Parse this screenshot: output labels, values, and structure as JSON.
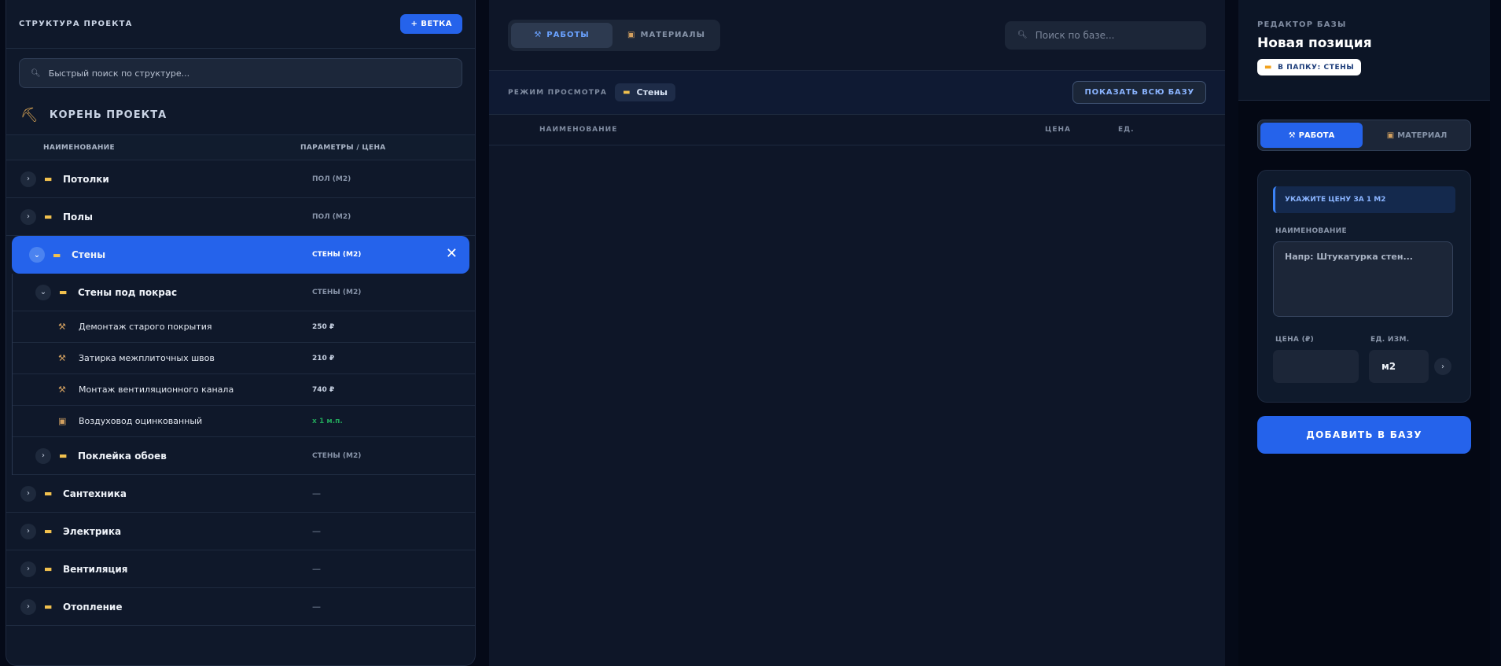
{
  "structure": {
    "title": "СТРУКТУРА ПРОЕКТА",
    "add_branch_label": "+ ВЕТКА",
    "search_placeholder": "Быстрый поиск по структуре...",
    "root_title": "КОРЕНЬ ПРОЕКТА",
    "col_name": "НАИМЕНОВАНИЕ",
    "col_params": "ПАРАМЕТРЫ / ЦЕНА",
    "items": [
      {
        "name": "Потолки",
        "param": "ПОЛ (М2)"
      },
      {
        "name": "Полы",
        "param": "ПОЛ (М2)"
      },
      {
        "name": "Стены",
        "param": "СТЕНЫ (М2)",
        "active": true
      },
      {
        "name": "Сантехника",
        "param": "—"
      },
      {
        "name": "Электрика",
        "param": "—"
      },
      {
        "name": "Вентиляция",
        "param": "—"
      },
      {
        "name": "Отопление",
        "param": "—"
      }
    ],
    "sub": {
      "paint": {
        "name": "Стены под покрас",
        "param": "СТЕНЫ (М2)"
      },
      "leaves": [
        {
          "name": "Демонтаж старого покрытия",
          "param": "250 ₽",
          "icon": "hammer-pick-icon"
        },
        {
          "name": "Затирка межплиточных швов",
          "param": "210 ₽",
          "icon": "hammer-pick-icon"
        },
        {
          "name": "Монтаж вентиляционного канала",
          "param": "740 ₽",
          "icon": "hammer-pick-icon"
        },
        {
          "name": "Воздуховод оцинкованный",
          "param": "x 1 м.п.",
          "icon": "material-box-icon"
        }
      ],
      "wallpaper": {
        "name": "Поклейка обоев",
        "param": "СТЕНЫ (М2)"
      }
    }
  },
  "catalog": {
    "tab_works": "РАБОТЫ",
    "tab_materials": "МАТЕРИАЛЫ",
    "search_placeholder": "Поиск по базе...",
    "view_mode_label": "РЕЖИМ ПРОСМОТРА",
    "view_folder": "Стены",
    "show_all_label": "ПОКАЗАТЬ ВСЮ БАЗУ",
    "col_name": "НАИМЕНОВАНИЕ",
    "col_price": "ЦЕНА",
    "col_unit": "ЕД."
  },
  "editor": {
    "kicker": "РЕДАКТОР БАЗЫ",
    "title": "Новая позиция",
    "folder_pill": "В ПАПКУ: СТЕНЫ",
    "type_work": "РАБОТА",
    "type_material": "МАТЕРИАЛ",
    "hint": "УКАЖИТЕ ЦЕНУ ЗА 1 М2",
    "name_label": "НАИМЕНОВАНИЕ",
    "name_placeholder": "Напр: Штукатурка стен...",
    "price_label": "ЦЕНА (₽)",
    "unit_label": "ЕД. ИЗМ.",
    "unit_value": "м2",
    "add_button": "ДОБАВИТЬ В БАЗУ"
  },
  "colors": {
    "accent": "#2563eb",
    "background": "#050a18",
    "panel": "#0f182a",
    "folder": "#f2c14e",
    "success": "#22a35a"
  }
}
